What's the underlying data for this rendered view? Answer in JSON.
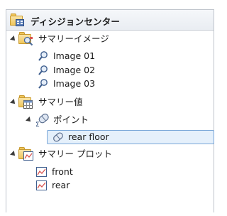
{
  "tree": {
    "root": {
      "label": "ディシジョンセンター",
      "icon": "decision-center-icon"
    },
    "summary_images": {
      "label": "サマリーイメージ",
      "icon": "folder-image-icon",
      "items": [
        {
          "label": "Image 01",
          "icon": "image-search-icon"
        },
        {
          "label": "Image 02",
          "icon": "image-search-icon"
        },
        {
          "label": "Image 03",
          "icon": "image-search-icon"
        }
      ]
    },
    "summary_values": {
      "label": "サマリー値",
      "icon": "folder-table-icon",
      "points": {
        "label": "ポイント",
        "icon": "point-sigma-icon",
        "items": [
          {
            "label": "rear floor",
            "icon": "point-icon",
            "selected": true
          }
        ]
      }
    },
    "summary_plots": {
      "label": "サマリー プロット",
      "icon": "folder-plot-icon",
      "items": [
        {
          "label": "front",
          "icon": "plot-icon"
        },
        {
          "label": "rear",
          "icon": "plot-icon"
        }
      ]
    }
  },
  "colors": {
    "selection_fill": "#e5f0fb",
    "selection_border": "#7aa7d8",
    "folder": "#efc65c"
  }
}
